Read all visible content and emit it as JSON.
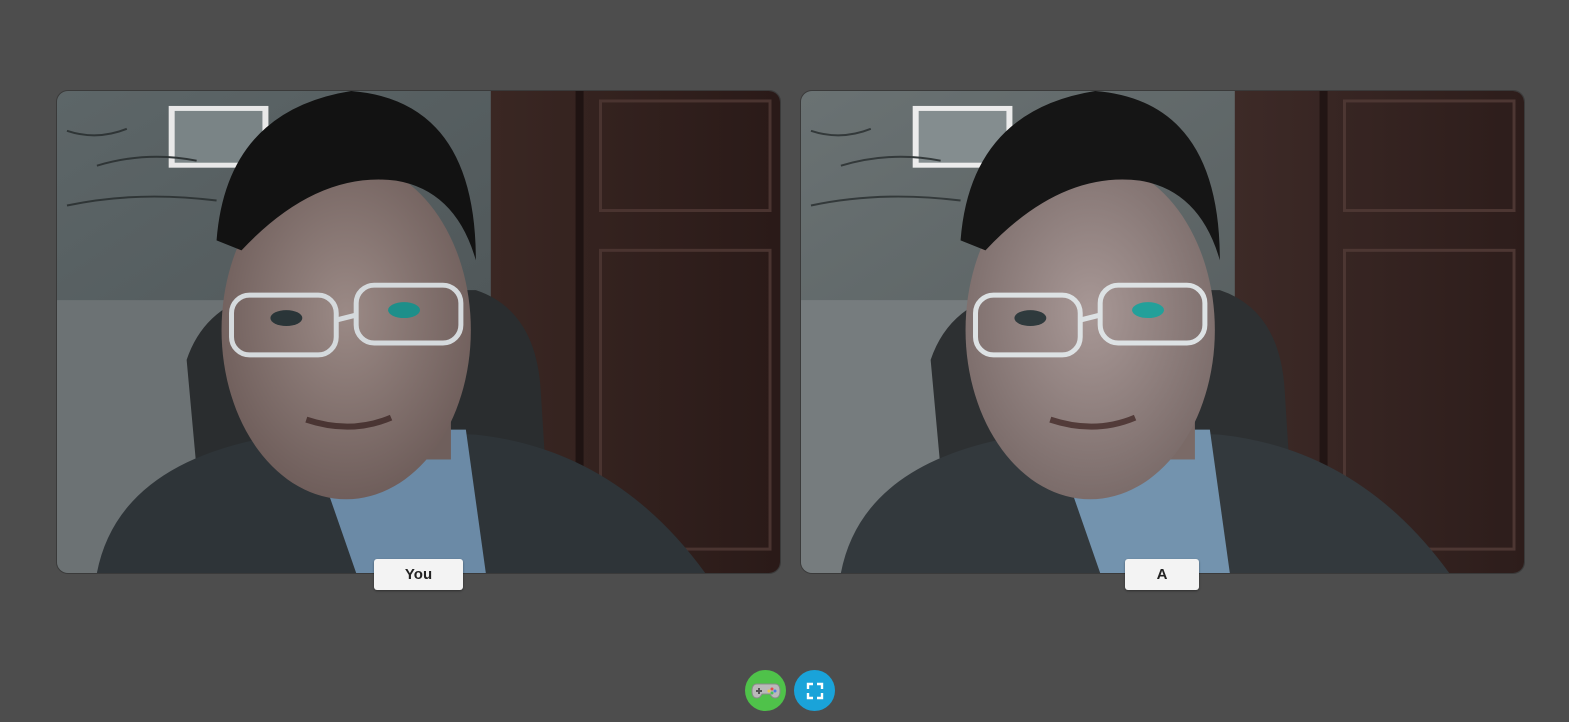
{
  "participants": {
    "local": {
      "label": "You"
    },
    "remote": {
      "label": "A"
    }
  },
  "controls": [
    {
      "name": "game-button",
      "icon": "gamepad-icon",
      "color": "#4fc24a"
    },
    {
      "name": "fullscreen-button",
      "icon": "fullscreen-icon",
      "color": "#1aa3d9"
    }
  ],
  "colors": {
    "background": "#4d4d4d",
    "label_bg": "#f3f3f3"
  }
}
